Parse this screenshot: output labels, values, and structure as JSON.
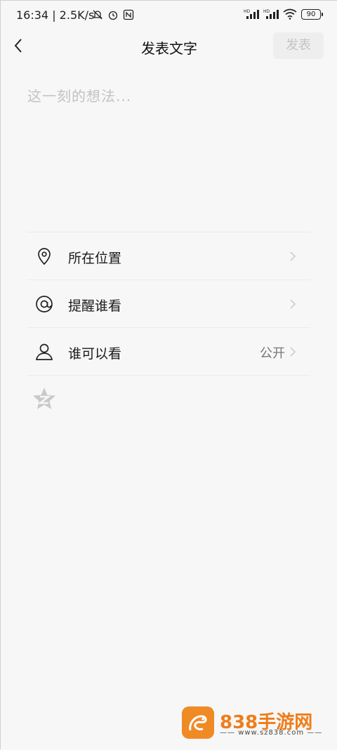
{
  "status_bar": {
    "time": "16:34",
    "speed": "| 2.5K/s",
    "battery": "90"
  },
  "header": {
    "title": "发表文字",
    "publish_label": "发表"
  },
  "editor": {
    "placeholder": "这一刻的想法..."
  },
  "options": [
    {
      "label": "所在位置",
      "value": "",
      "icon": "location-pin-icon"
    },
    {
      "label": "提醒谁看",
      "value": "",
      "icon": "at-icon"
    },
    {
      "label": "谁可以看",
      "value": "公开",
      "icon": "person-icon"
    }
  ],
  "watermark": {
    "brand": "838手游网",
    "url": "www.sz838.com"
  }
}
